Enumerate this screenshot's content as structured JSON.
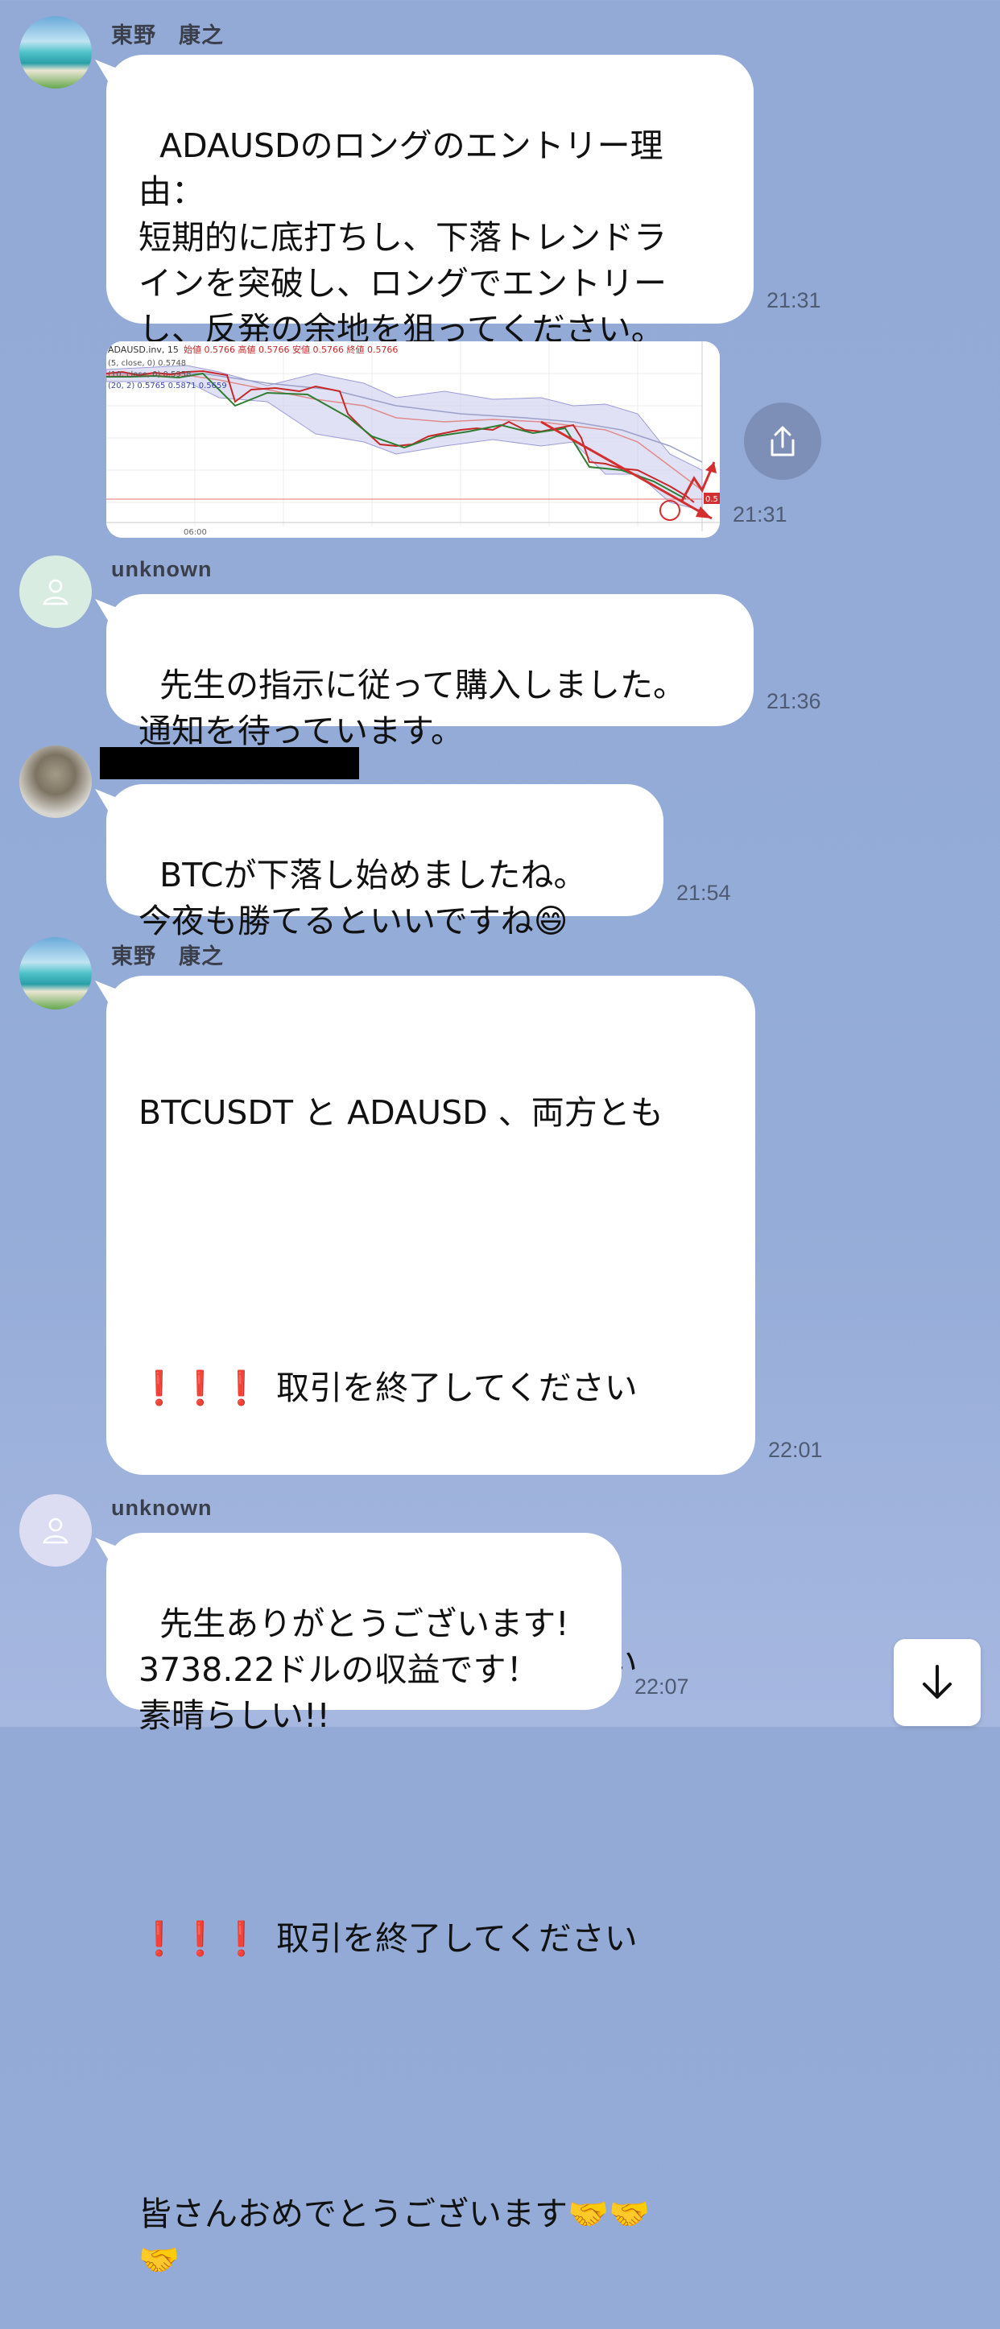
{
  "messages": [
    {
      "sender": "東野　康之",
      "time": "21:31",
      "text": "ADAUSDのロングのエントリー理\n由：\n短期的に底打ちし、下落トレンドラ\nインを突破し、ロングでエントリー\nし、反発の余地を狙ってください。"
    },
    {
      "time": "21:31",
      "chart": {
        "title": "ADAUSD.inv, 15",
        "ohlc": "始値 0.5766  高値 0.5766  安値 0.5766  終値 0.5766",
        "line2": "(5, close, 0)  0.5748",
        "line3": "(10, close, 0)  0.5958",
        "line4": "(20, 2)  0.5765  0.5871  0.5659",
        "xlabel": "06:00",
        "price_tag": "0.5"
      }
    },
    {
      "sender": "unknown",
      "time": "21:36",
      "text": "先生の指示に従って購入しました。\n通知を待っています。"
    },
    {
      "sender": "",
      "time": "21:54",
      "text": "BTCが下落し始めましたね。\n今夜も勝てるといいですね😄"
    },
    {
      "sender": "東野　康之",
      "time": "22:01",
      "line1": "BTCUSDT と ADAUSD 、両方とも",
      "excl": "❗️❗️❗️",
      "close_text": "取引を終了してください",
      "congrats": "皆さんおめでとうございます🤝🤝\n🤝"
    },
    {
      "sender": "unknown",
      "time": "22:07",
      "text": "先生ありがとうございます!\n3738.22ドルの収益です！\n素晴らしい!!"
    }
  ],
  "icons": {
    "share": "share-icon",
    "scroll_down": "arrow-down-icon",
    "person": "person-icon"
  }
}
